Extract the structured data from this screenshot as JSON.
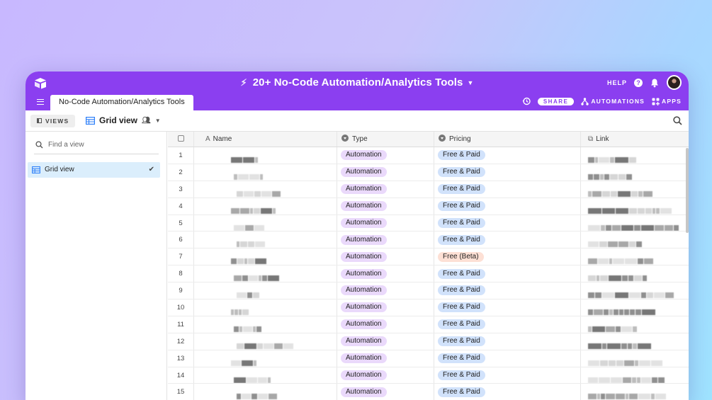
{
  "app": {
    "base_title": "20+ No-Code Automation/Analytics Tools",
    "help_label": "HELP",
    "table_tab": "No-Code Automation/Analytics Tools",
    "share_label": "SHARE",
    "automations_label": "AUTOMATIONS",
    "apps_label": "APPS",
    "accent_color": "#8b3ff0"
  },
  "viewbar": {
    "views_label": "VIEWS",
    "current_view": "Grid view"
  },
  "sidebar": {
    "find_placeholder": "Find a view",
    "views": [
      {
        "label": "Grid view",
        "selected": true
      }
    ]
  },
  "grid": {
    "columns": [
      {
        "label": "Name",
        "icon": "text-field-icon"
      },
      {
        "label": "Type",
        "icon": "single-select-icon"
      },
      {
        "label": "Pricing",
        "icon": "single-select-icon"
      },
      {
        "label": "Link",
        "icon": "url-icon"
      }
    ],
    "rows": [
      {
        "n": "1",
        "type": "Automation",
        "pricing": "Free & Paid"
      },
      {
        "n": "2",
        "type": "Automation",
        "pricing": "Free & Paid"
      },
      {
        "n": "3",
        "type": "Automation",
        "pricing": "Free & Paid"
      },
      {
        "n": "4",
        "type": "Automation",
        "pricing": "Free & Paid"
      },
      {
        "n": "5",
        "type": "Automation",
        "pricing": "Free & Paid"
      },
      {
        "n": "6",
        "type": "Automation",
        "pricing": "Free & Paid"
      },
      {
        "n": "7",
        "type": "Automation",
        "pricing": "Free (Beta)"
      },
      {
        "n": "8",
        "type": "Automation",
        "pricing": "Free & Paid"
      },
      {
        "n": "9",
        "type": "Automation",
        "pricing": "Free & Paid"
      },
      {
        "n": "10",
        "type": "Automation",
        "pricing": "Free & Paid"
      },
      {
        "n": "11",
        "type": "Automation",
        "pricing": "Free & Paid"
      },
      {
        "n": "12",
        "type": "Automation",
        "pricing": "Free & Paid"
      },
      {
        "n": "13",
        "type": "Automation",
        "pricing": "Free & Paid"
      },
      {
        "n": "14",
        "type": "Automation",
        "pricing": "Free & Paid"
      },
      {
        "n": "15",
        "type": "Automation",
        "pricing": "Free & Paid"
      }
    ]
  }
}
